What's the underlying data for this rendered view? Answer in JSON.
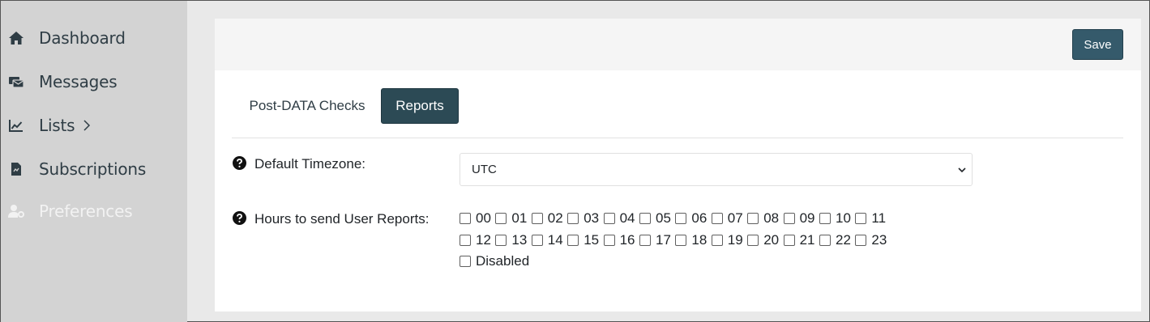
{
  "sidebar": {
    "items": [
      {
        "label": "Dashboard",
        "icon": "home-icon"
      },
      {
        "label": "Messages",
        "icon": "messages-icon"
      },
      {
        "label": "Lists",
        "icon": "chart-line-icon"
      },
      {
        "label": "Subscriptions",
        "icon": "file-icon"
      },
      {
        "label": "Preferences",
        "icon": "user-cog-icon"
      }
    ]
  },
  "toolbar": {
    "save_label": "Save"
  },
  "tabs": [
    {
      "label": "Post-DATA Checks",
      "active": false
    },
    {
      "label": "Reports",
      "active": true
    }
  ],
  "form": {
    "timezone": {
      "label": "Default Timezone:",
      "value": "UTC"
    },
    "hours": {
      "label": "Hours to send User Reports:",
      "options": [
        "00",
        "01",
        "02",
        "03",
        "04",
        "05",
        "06",
        "07",
        "08",
        "09",
        "10",
        "11",
        "12",
        "13",
        "14",
        "15",
        "16",
        "17",
        "18",
        "19",
        "20",
        "21",
        "22",
        "23"
      ],
      "disabled_label": "Disabled"
    }
  },
  "colors": {
    "sidebar_bg": "#d3d3d3",
    "accent": "#2c4a55",
    "save_button": "#355a6b",
    "topbar_bg": "#f5f5f5"
  }
}
